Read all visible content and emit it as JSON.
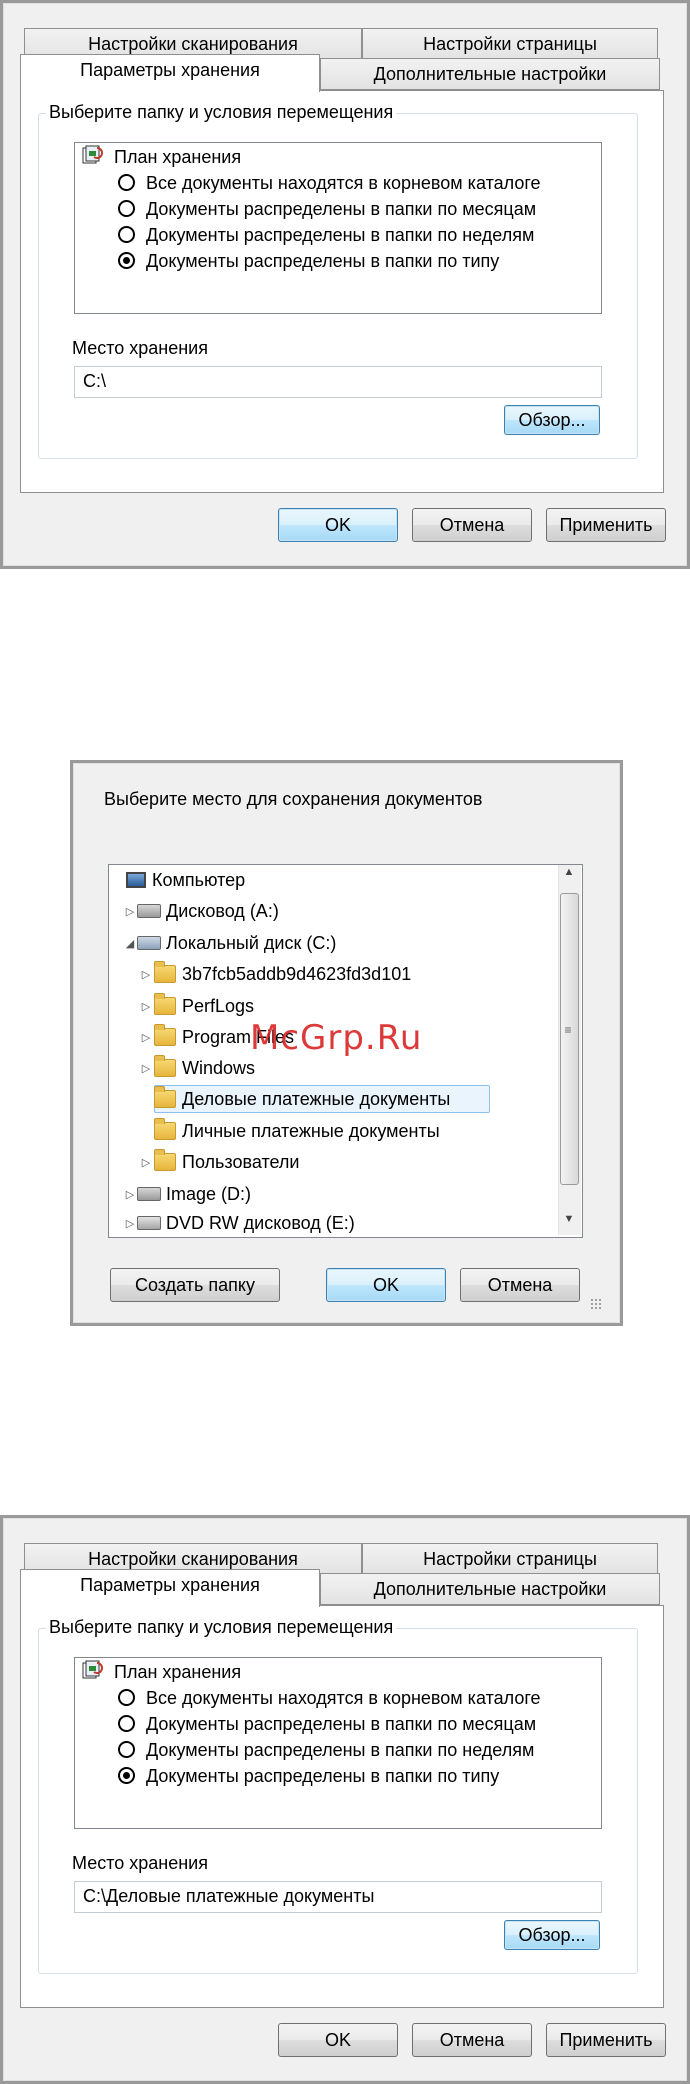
{
  "dialog1": {
    "tabs": [
      "Настройки сканирования",
      "Настройки страницы",
      "Параметры хранения",
      "Дополнительные настройки"
    ],
    "group_title": "Выберите папку и условия перемещения",
    "plan_title": "План хранения",
    "options": [
      "Все документы находятся в корневом каталоге",
      "Документы распределены в папки по месяцам",
      "Документы распределены в папки по неделям",
      "Документы распределены в папки по типу"
    ],
    "selected_option": 3,
    "location_label": "Место хранения",
    "location_value": "C:\\",
    "browse_label": "Обзор...",
    "ok_label": "OK",
    "cancel_label": "Отмена",
    "apply_label": "Применить"
  },
  "browse_dialog": {
    "prompt": "Выберите место для сохранения документов",
    "tree": [
      {
        "label": "Компьютер",
        "level": 0,
        "expander": "",
        "icon": "computer-icon"
      },
      {
        "label": "Дисковод (A:)",
        "level": 1,
        "expander": "▷",
        "icon": "floppy-drive-icon"
      },
      {
        "label": "Локальный диск (C:)",
        "level": 1,
        "expander": "◢",
        "icon": "local-disk-icon"
      },
      {
        "label": "3b7fcb5addb9d4623fd3d101",
        "level": 2,
        "expander": "▷",
        "icon": "folder-icon"
      },
      {
        "label": "PerfLogs",
        "level": 2,
        "expander": "▷",
        "icon": "folder-icon"
      },
      {
        "label": "Program Files",
        "level": 2,
        "expander": "▷",
        "icon": "folder-icon"
      },
      {
        "label": "Windows",
        "level": 2,
        "expander": "▷",
        "icon": "folder-icon"
      },
      {
        "label": "Деловые платежные документы",
        "level": 2,
        "expander": "",
        "icon": "folder-icon",
        "selected": true
      },
      {
        "label": "Личные платежные документы",
        "level": 2,
        "expander": "",
        "icon": "folder-icon"
      },
      {
        "label": "Пользователи",
        "level": 2,
        "expander": "▷",
        "icon": "folder-icon"
      },
      {
        "label": "Image (D:)",
        "level": 1,
        "expander": "▷",
        "icon": "drive-icon"
      },
      {
        "label": "DVD RW дисковод (E:)",
        "level": 1,
        "expander": "▷",
        "icon": "dvd-drive-icon"
      }
    ],
    "new_folder_label": "Создать папку",
    "ok_label": "OK",
    "cancel_label": "Отмена"
  },
  "watermark": "McGrp.Ru",
  "dialog2": {
    "tabs": [
      "Настройки сканирования",
      "Настройки страницы",
      "Параметры хранения",
      "Дополнительные настройки"
    ],
    "group_title": "Выберите папку и условия перемещения",
    "plan_title": "План хранения",
    "options": [
      "Все документы находятся в корневом каталоге",
      "Документы распределены в папки по месяцам",
      "Документы распределены в папки по неделям",
      "Документы распределены в папки по типу"
    ],
    "selected_option": 3,
    "location_label": "Место хранения",
    "location_value": "C:\\Деловые платежные документы",
    "browse_label": "Обзор...",
    "ok_label": "OK",
    "cancel_label": "Отмена",
    "apply_label": "Применить"
  },
  "colors": {
    "selection_bg": "#eaf4fc",
    "selection_border": "#8dc0ea",
    "watermark": "#d71e1e",
    "default_button_border": "#3c7fb1"
  }
}
